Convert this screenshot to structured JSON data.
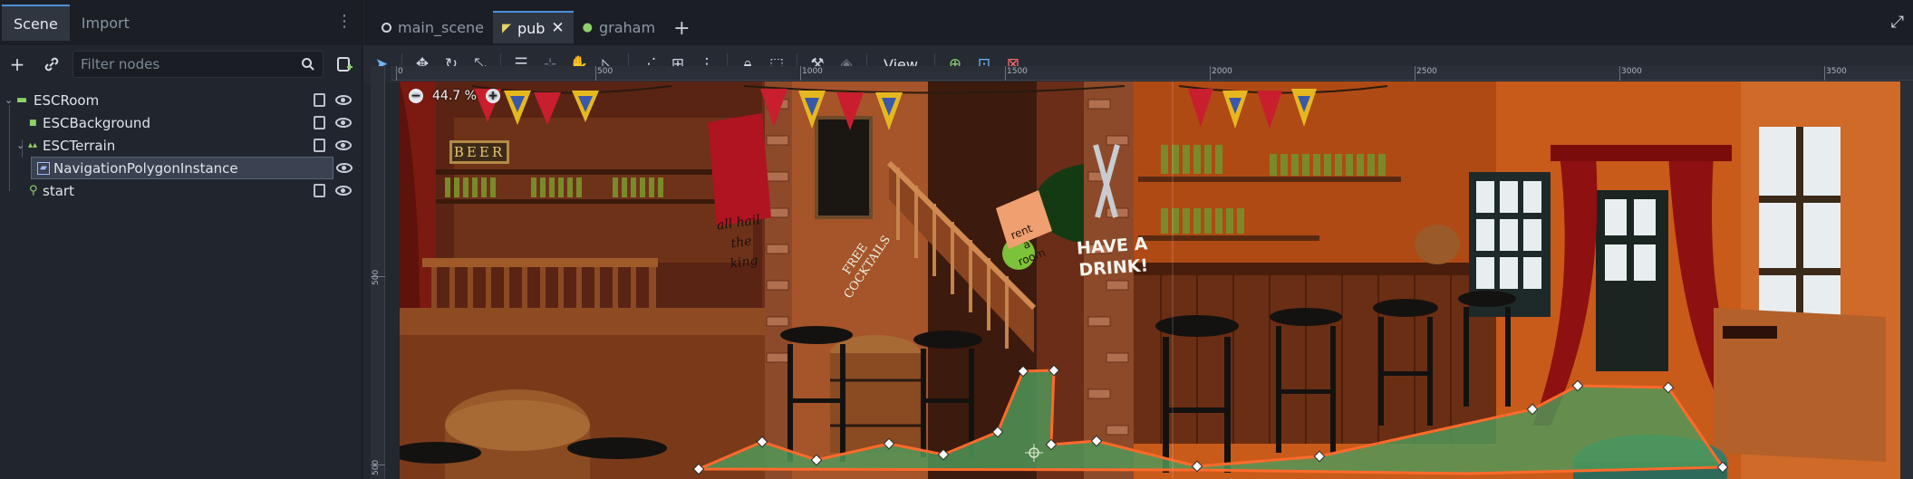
{
  "dock": {
    "tabs": [
      "Scene",
      "Import"
    ],
    "filter_placeholder": "Filter nodes",
    "tree": [
      {
        "label": "ESCRoom",
        "icon": "room-node-icon",
        "color": "#8ed16b"
      },
      {
        "label": "ESCBackground",
        "icon": "background-node-icon",
        "color": "#8ed16b"
      },
      {
        "label": "ESCTerrain",
        "icon": "terrain-node-icon",
        "color": "#8ed16b"
      },
      {
        "label": "NavigationPolygonInstance",
        "icon": "navigation-polygon-icon",
        "color": "#9fb6ff"
      },
      {
        "label": "start",
        "icon": "position-node-icon",
        "color": "#8ed16b"
      }
    ]
  },
  "editor": {
    "scene_tabs": [
      {
        "label": "main_scene",
        "icon": "scene-icon"
      },
      {
        "label": "pub",
        "icon": "script-scene-icon",
        "active": true
      },
      {
        "label": "graham",
        "icon": "character-scene-icon"
      }
    ],
    "view_label": "View",
    "zoom": "44.7 %",
    "ruler_labels": [
      "0",
      "500",
      "1000",
      "1500",
      "2000",
      "2500",
      "3000",
      "3500"
    ],
    "vruler_labels": [
      "500",
      "500"
    ]
  },
  "art": {
    "beer_sign": "BEER",
    "poster_lines": [
      "all hail",
      "the",
      "king"
    ],
    "cocktails_lines": [
      "FREE",
      "COCKTAILS"
    ],
    "rent_lines": [
      "rent",
      "a",
      "room"
    ],
    "drink_lines": [
      "HAVE A",
      "DRINK!"
    ]
  }
}
